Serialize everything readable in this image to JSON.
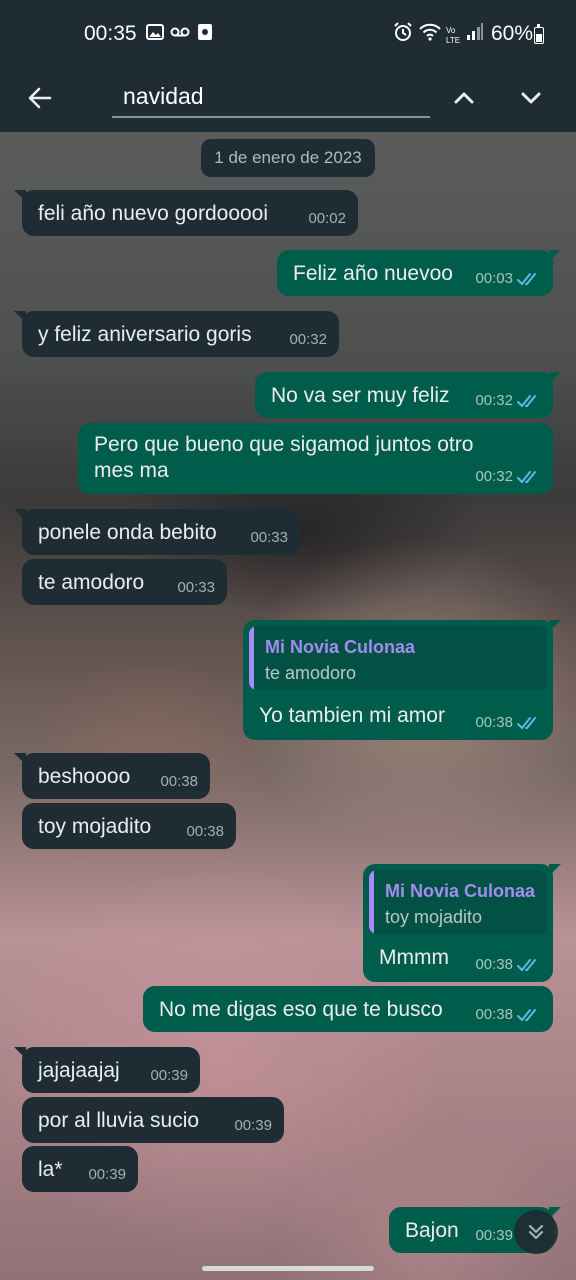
{
  "status_bar": {
    "time": "00:35",
    "battery": "60%",
    "icons": [
      "image-icon",
      "voicemail-icon",
      "record-icon",
      "alarm-icon",
      "wifi-icon",
      "volte-icon",
      "signal-icon",
      "battery-icon"
    ]
  },
  "search": {
    "query": "navidad"
  },
  "date_separator": "1 de enero de 2023",
  "messages": [
    {
      "dir": "in",
      "text": "feli año nuevo gordooooi",
      "time": "00:02"
    },
    {
      "dir": "out",
      "text": "Feliz año nuevoo",
      "time": "00:03"
    },
    {
      "dir": "in",
      "text": "y feliz aniversario goris",
      "time": "00:32"
    },
    {
      "dir": "out",
      "text": "No va ser muy feliz",
      "time": "00:32"
    },
    {
      "dir": "out",
      "text_line1": "Pero que bueno que sigamod juntos otro",
      "text_line2": "mes ma",
      "time": "00:32"
    },
    {
      "dir": "in",
      "text": "ponele onda bebito",
      "time": "00:33"
    },
    {
      "dir": "in",
      "text": "te amodoro",
      "time": "00:33"
    },
    {
      "dir": "out",
      "quote_author": "Mi Novia Culonaa",
      "quote_text": "te amodoro",
      "text": "Yo tambien mi amor",
      "time": "00:38"
    },
    {
      "dir": "in",
      "text": "beshoooo",
      "time": "00:38"
    },
    {
      "dir": "in",
      "text": "toy mojadito",
      "time": "00:38"
    },
    {
      "dir": "out",
      "quote_author": "Mi Novia Culonaa",
      "quote_text": "toy mojadito",
      "text": "Mmmm",
      "time": "00:38"
    },
    {
      "dir": "out",
      "text": "No me digas eso que te busco",
      "time": "00:38"
    },
    {
      "dir": "in",
      "text": "jajajaajaj",
      "time": "00:39"
    },
    {
      "dir": "in",
      "text": "por al lluvia sucio",
      "time": "00:39"
    },
    {
      "dir": "in",
      "text": "la*",
      "time": "00:39"
    },
    {
      "dir": "out",
      "text": "Bajon",
      "time": "00:39"
    }
  ],
  "colors": {
    "header": "#1f2c34",
    "incoming_bubble": "#1f2c34",
    "outgoing_bubble": "#005c4b",
    "read_ticks": "#53bdeb",
    "quote_accent": "#a78bfa"
  }
}
